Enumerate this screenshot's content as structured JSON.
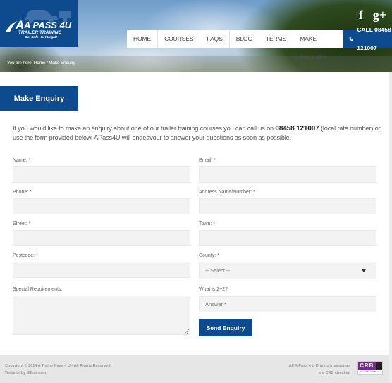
{
  "brand": {
    "name": "A PASS 4U",
    "tagline_1": "TRAILER TRAINING",
    "tagline_2": "Get Safe! Get Legal!",
    "primary_color": "#0d4a8e"
  },
  "social": {
    "facebook_icon": "f",
    "googleplus_icon": "g+"
  },
  "nav": {
    "items": [
      {
        "label": "HOME"
      },
      {
        "label": "COURSES"
      },
      {
        "label": "FAQS"
      },
      {
        "label": "BLOG"
      },
      {
        "label": "TERMS"
      },
      {
        "label": "MAKE ENQUIRY"
      }
    ],
    "call_label": "CALL 08458 121007"
  },
  "breadcrumb": {
    "prefix": "You are here:",
    "home": "Home",
    "separator": "/",
    "current": "Make Enquiry"
  },
  "page": {
    "title": "Make Enquiry",
    "intro_before": "If you would like to make an enquiry about one of our trailer training courses you can call us on ",
    "intro_phone": "08458 121007",
    "intro_after": " (local rate number) or use the form provided below. APass4U will endeavour to answer your questions as soon as possible."
  },
  "form": {
    "name": {
      "label": "Name: *",
      "value": ""
    },
    "email": {
      "label": "Email: *",
      "value": ""
    },
    "phone": {
      "label": "Phone: *",
      "value": ""
    },
    "address": {
      "label": "Address Name/Number: *",
      "value": ""
    },
    "street": {
      "label": "Street: *",
      "value": ""
    },
    "town": {
      "label": "Town: *",
      "value": ""
    },
    "postcode": {
      "label": "Postcode: *",
      "value": ""
    },
    "county": {
      "label": "County: *",
      "selected": "-- Select --"
    },
    "special": {
      "label": "Special Requirements:",
      "value": ""
    },
    "captcha": {
      "label": "What is 2+2?",
      "placeholder": "Answer *"
    },
    "submit_label": "Send Enquiry"
  },
  "footer": {
    "copyright": "Copyright © 2014 A Trailer Pass 4 U - All Rights Reserved",
    "credit": "Website by Silkstream",
    "crb_line_1": "All A Pass 4 U Driving Instructors",
    "crb_line_2": "are CRB checked",
    "crb_badge": "CRB",
    "crb_badge_sub": "Criminal Records Bureau"
  }
}
